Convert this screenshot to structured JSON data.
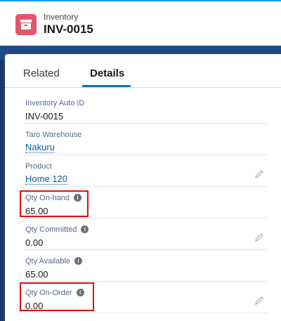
{
  "header": {
    "object_label": "Inventory",
    "record_title": "INV-0015",
    "icon": "inventory-archive-icon"
  },
  "tabs": [
    {
      "label": "Related",
      "active": false
    },
    {
      "label": "Details",
      "active": true
    }
  ],
  "fields": [
    {
      "label": "Inventory Auto ID",
      "value": "INV-0015"
    },
    {
      "label": "Taro Warehouse",
      "value": "Nakuru",
      "link": true
    },
    {
      "label": "Product",
      "value": "Home 120",
      "link": true,
      "editable": true
    },
    {
      "label": "Qty On-hand",
      "value": "65.00",
      "info": true,
      "highlighted": true
    },
    {
      "label": "Qty Committed",
      "value": "0.00",
      "info": true,
      "editable": true
    },
    {
      "label": "Qty Available",
      "value": "65.00",
      "info": true
    },
    {
      "label": "Qty On-Order",
      "value": "0.00",
      "info": true,
      "editable": true,
      "highlighted": true
    }
  ],
  "colors": {
    "accent": "#0176d3",
    "highlight": "#e01010",
    "app_icon": "#e3566d"
  }
}
